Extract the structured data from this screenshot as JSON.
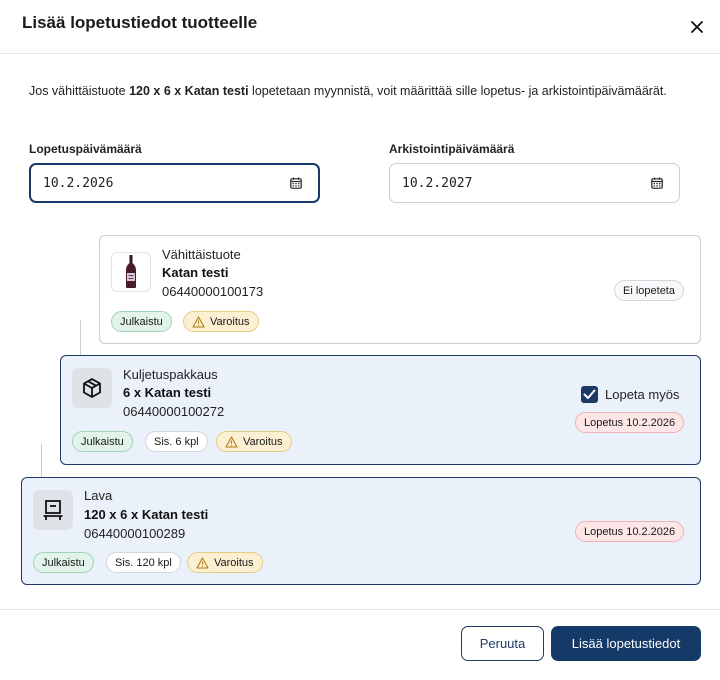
{
  "dialog": {
    "title": "Lisää lopetustiedot tuotteelle",
    "intro": {
      "before": "Jos vähittäistuote ",
      "product": "120 x 6 x Katan testi",
      "after": " lopetetaan myynnistä, voit määrittää sille lopetus- ja arkistointipäivämäärät."
    }
  },
  "fields": {
    "end_date": {
      "label": "Lopetuspäivämäärä",
      "value": "10.2.2026"
    },
    "archive_date": {
      "label": "Arkistointipäivämäärä",
      "value": "10.2.2027"
    }
  },
  "items": [
    {
      "type": "Vähittäistuote",
      "name": "Katan testi",
      "gtin": "06440000100173",
      "status": "Julkaistu",
      "warning": "Varoitus",
      "end_badge": "Ei lopeteta"
    },
    {
      "type": "Kuljetuspakkaus",
      "name": "6 x Katan testi",
      "gtin": "06440000100272",
      "status": "Julkaistu",
      "contains": "Sis. 6 kpl",
      "warning": "Varoitus",
      "checkbox_label": "Lopeta myös",
      "checkbox_checked": true,
      "end_badge": "Lopetus 10.2.2026"
    },
    {
      "type": "Lava",
      "name": "120 x 6 x Katan testi",
      "gtin": "06440000100289",
      "status": "Julkaistu",
      "contains": "Sis. 120 kpl",
      "warning": "Varoitus",
      "end_badge": "Lopetus 10.2.2026"
    }
  ],
  "footer": {
    "cancel_label": "Peruuta",
    "submit_label": "Lisää lopetustiedot"
  },
  "colors": {
    "primary": "#163a68",
    "card_highlight": "#eaf1fb",
    "published": "#e2f4ea",
    "warning": "#fbf0d2",
    "ending": "#fde6e6"
  }
}
